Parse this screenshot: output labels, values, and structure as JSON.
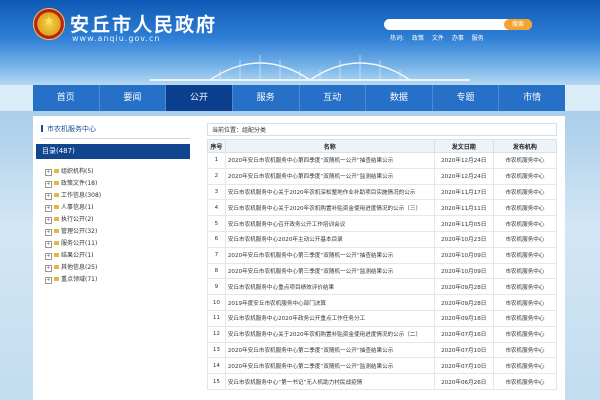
{
  "header": {
    "title": "安丘市人民政府",
    "url": "www.anqiu.gov.cn",
    "search_placeholder": "",
    "search_button": "搜索",
    "hot_label": "热词:",
    "hot_words": [
      "政策",
      "文件",
      "办事",
      "服务"
    ]
  },
  "nav": {
    "items": [
      "首页",
      "要闻",
      "公开",
      "服务",
      "互动",
      "数据",
      "专题",
      "市情"
    ],
    "active": "公开"
  },
  "sidebar": {
    "title": "市农机服务中心",
    "catalog": "目录(487)",
    "items": [
      {
        "label": "组织机构(5)"
      },
      {
        "label": "政策文件(18)"
      },
      {
        "label": "工作信息(308)"
      },
      {
        "label": "人事信息(1)"
      },
      {
        "label": "执行公开(2)"
      },
      {
        "label": "管理公开(32)"
      },
      {
        "label": "服务公开(11)"
      },
      {
        "label": "结果公开(1)"
      },
      {
        "label": "其他信息(25)"
      },
      {
        "label": "重点领域(71)"
      }
    ]
  },
  "main": {
    "breadcrumb": "当前位置：组配分类",
    "headers": {
      "no": "序号",
      "name": "名称",
      "date": "发文日期",
      "org": "发布机构"
    },
    "rows": [
      {
        "no": "1",
        "name": "2020年安丘市农机服务中心第四季度“双随机一公开”抽查结果公示",
        "date": "2020年12月24日",
        "org": "市农机服务中心"
      },
      {
        "no": "2",
        "name": "2020年安丘市农机服务中心第四季度“双随机一公开”监测结果公示",
        "date": "2020年12月24日",
        "org": "市农机服务中心"
      },
      {
        "no": "3",
        "name": "安丘市农机服务中心关于2020年农机深松整地作业补助项目实施情况的公示",
        "date": "2020年11月17日",
        "org": "市农机服务中心"
      },
      {
        "no": "4",
        "name": "安丘市农机服务中心关于2020年农机购置补贴资金使用进度情况的公示（三）",
        "date": "2020年11月11日",
        "org": "市农机服务中心"
      },
      {
        "no": "5",
        "name": "安丘市农机服务中心召开政务公开工作培训会议",
        "date": "2020年11月05日",
        "org": "市农机服务中心"
      },
      {
        "no": "6",
        "name": "安丘市农机服务中心2020年主动公开基本目录",
        "date": "2020年10月23日",
        "org": "市农机服务中心"
      },
      {
        "no": "7",
        "name": "2020年安丘市农机服务中心第三季度“双随机一公开”抽查结果公示",
        "date": "2020年10月09日",
        "org": "市农机服务中心"
      },
      {
        "no": "8",
        "name": "2020年安丘市农机服务中心第三季度“双随机一公开”监测结果公示",
        "date": "2020年10月09日",
        "org": "市农机服务中心"
      },
      {
        "no": "9",
        "name": "安丘市农机服务中心重点项目绩效评价结果",
        "date": "2020年09月28日",
        "org": "市农机服务中心"
      },
      {
        "no": "10",
        "name": "2019年度安丘市农机服务中心部门决算",
        "date": "2020年09月28日",
        "org": "市农机服务中心"
      },
      {
        "no": "11",
        "name": "安丘市农机服务中心2020年政务公开重点工作任务分工",
        "date": "2020年09月18日",
        "org": "市农机服务中心"
      },
      {
        "no": "12",
        "name": "安丘市农机服务中心关于2020年农机购置补贴资金使用进度情况的公示（二）",
        "date": "2020年07月16日",
        "org": "市农机服务中心"
      },
      {
        "no": "13",
        "name": "2020年安丘市农机服务中心第二季度“双随机一公开”抽查结果公示",
        "date": "2020年07月10日",
        "org": "市农机服务中心"
      },
      {
        "no": "14",
        "name": "2020年安丘市农机服务中心第二季度“双随机一公开”监测结果公示",
        "date": "2020年07月10日",
        "org": "市农机服务中心"
      },
      {
        "no": "15",
        "name": "安丘市农机服务中心“第一书记”无人机助力村民战疫情",
        "date": "2020年06月26日",
        "org": "市农机服务中心"
      }
    ]
  }
}
